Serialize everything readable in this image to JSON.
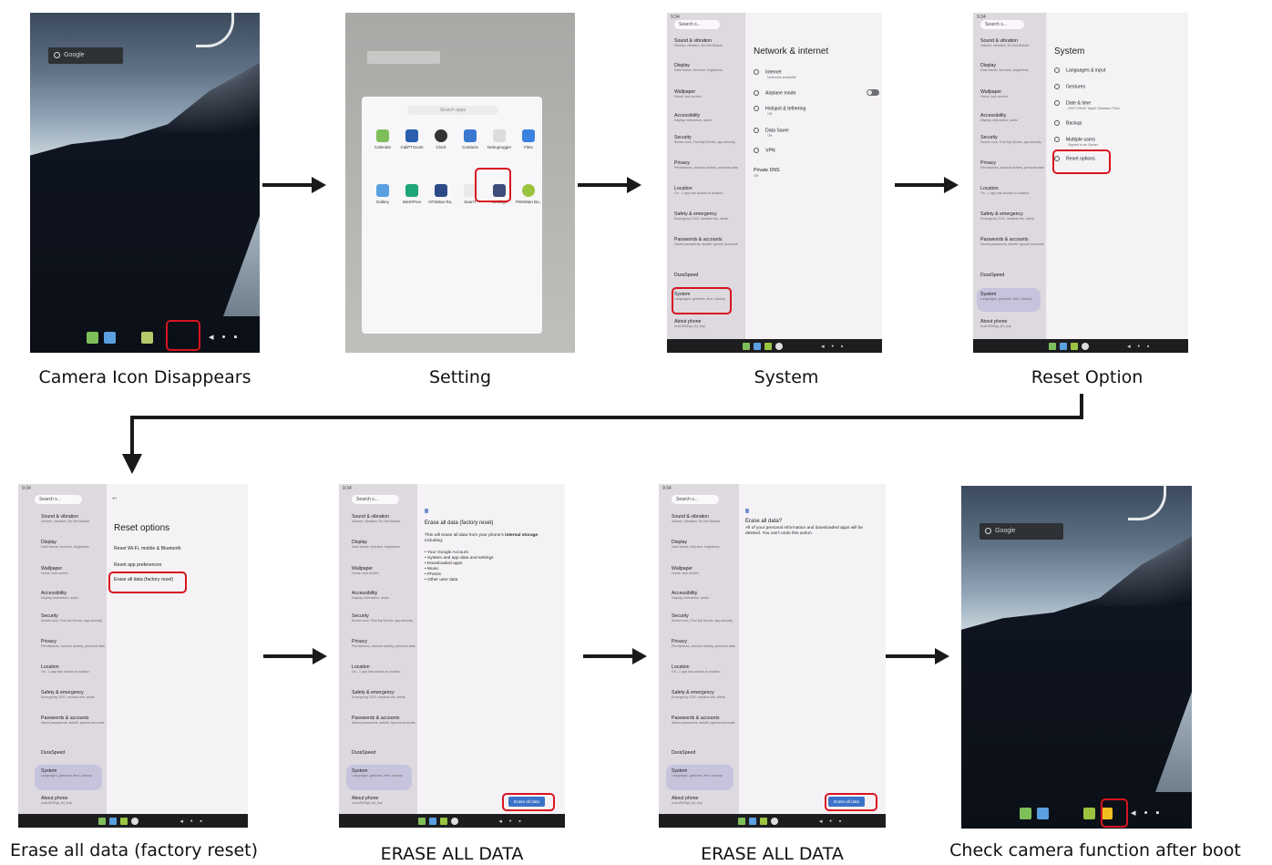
{
  "captions": {
    "step1": "Camera Icon Disappears",
    "step2": "Setting",
    "step3": "System",
    "step4": "Reset Option",
    "step5": "Erase all data (factory reset)",
    "step6": "ERASE ALL DATA",
    "step7": "ERASE ALL DATA",
    "step8": "Check camera function after boot"
  },
  "home": {
    "search_label": "Google"
  },
  "drawer": {
    "search_placeholder": "Search apps",
    "apps_row1": [
      "Calendar",
      "CaliPTSoots",
      "Clock",
      "Contacts",
      "Debugrogger",
      "Files"
    ],
    "apps_row2": [
      "Gallery",
      "MeshPrev",
      "NTSMan Ra..",
      "SearIT",
      "Settings",
      "PWSMan Bo.."
    ]
  },
  "settings": {
    "status_time": "9:34",
    "search_placeholder": "Search s...",
    "side_items": [
      {
        "label": "Sound & vibration",
        "sub": "Volume, vibration, Do Not Disturb"
      },
      {
        "label": "Display",
        "sub": "Dark theme, font size, brightness"
      },
      {
        "label": "Wallpaper",
        "sub": "Home, lock screen"
      },
      {
        "label": "Accessibility",
        "sub": "Display, interaction, audio"
      },
      {
        "label": "Security",
        "sub": "Screen lock, Find My Device, app security"
      },
      {
        "label": "Privacy",
        "sub": "Permissions, account activity, personal data"
      },
      {
        "label": "Location",
        "sub": "On - 1 app has access to location"
      },
      {
        "label": "Safety & emergency",
        "sub": "Emergency SOS, medical info, alerts"
      },
      {
        "label": "Passwords & accounts",
        "sub": "Saved passwords, autofill, synced accounts"
      },
      {
        "label": "DuraSpeed",
        "sub": ""
      },
      {
        "label": "System",
        "sub": "Languages, gestures, time, backup"
      },
      {
        "label": "About phone",
        "sub": "ecAUSSEqa_64_bsp"
      }
    ],
    "network": {
      "title": "Network & internet",
      "rows": [
        {
          "label": "Internet",
          "sub": "Networks available"
        },
        {
          "label": "Airplane mode",
          "sub": ""
        },
        {
          "label": "Hotspot & tethering",
          "sub": "Off"
        },
        {
          "label": "Data Saver",
          "sub": "Off"
        },
        {
          "label": "VPN",
          "sub": ""
        },
        {
          "label": "Private DNS",
          "sub": "Off"
        }
      ]
    },
    "system": {
      "title": "System",
      "rows": [
        {
          "label": "Languages & input",
          "sub": ""
        },
        {
          "label": "Gestures",
          "sub": ""
        },
        {
          "label": "Date & time",
          "sub": "GMT+08:00 Taipei Standard Time"
        },
        {
          "label": "Backup",
          "sub": ""
        },
        {
          "label": "Multiple users",
          "sub": "Signed in as Owner"
        },
        {
          "label": "Reset options",
          "sub": ""
        }
      ]
    },
    "reset": {
      "back": "←",
      "title": "Reset options",
      "rows": [
        "Reset Wi-Fi, mobile & Bluetooth",
        "Reset app preferences",
        "Erase all data (factory reset)"
      ]
    },
    "erase1": {
      "title": "Erase all data (factory reset)",
      "body_prefix": "This will erase all data from your phone's",
      "body_bold": "internal storage",
      "body_suffix": ", including:",
      "list": [
        "• Your Google Account",
        "• System and app data and settings",
        "• Downloaded apps",
        "• Music",
        "• Photos",
        "• Other user data"
      ],
      "button": "Erase all data"
    },
    "erase2": {
      "title": "Erase all data?",
      "body": "All of your personal information and downloaded apps will be deleted. You can't undo this action.",
      "button": "Erase all data"
    }
  },
  "colors": {
    "highlight": "#d8141f",
    "arrow": "#1a1a1a",
    "accent": "#3c72c8"
  }
}
